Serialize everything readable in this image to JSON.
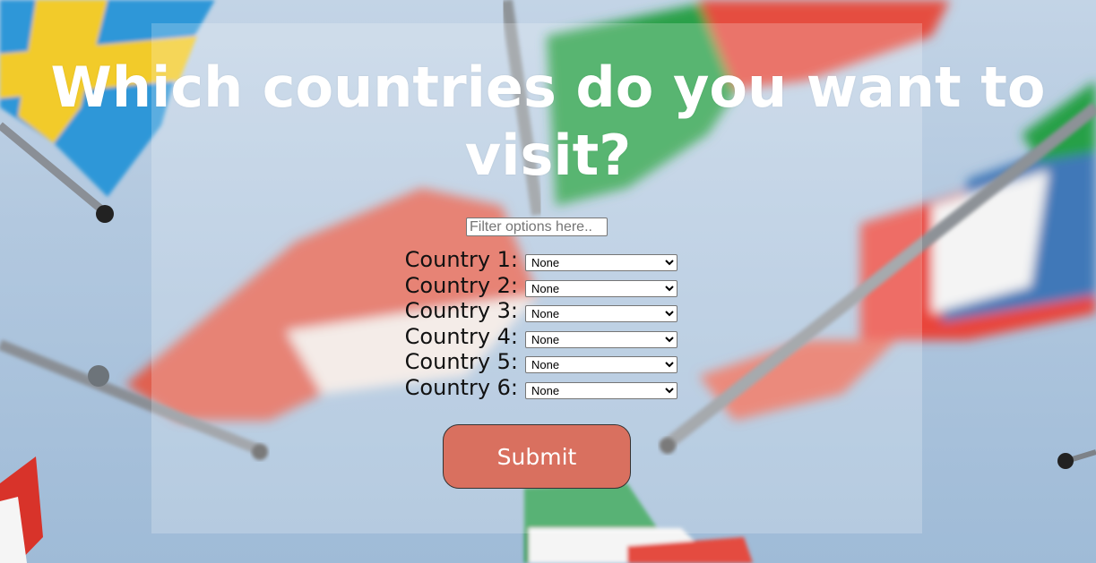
{
  "title": "Which countries do you want to visit?",
  "filter": {
    "placeholder": "Filter options here..",
    "value": ""
  },
  "countries": [
    {
      "label": "Country 1:",
      "selected": "None"
    },
    {
      "label": "Country 2:",
      "selected": "None"
    },
    {
      "label": "Country 3:",
      "selected": "None"
    },
    {
      "label": "Country 4:",
      "selected": "None"
    },
    {
      "label": "Country 5:",
      "selected": "None"
    },
    {
      "label": "Country 6:",
      "selected": "None"
    }
  ],
  "submit_label": "Submit",
  "colors": {
    "submit_bg": "#d9705f",
    "title": "#ffffff",
    "sky": "#b2c8df"
  }
}
